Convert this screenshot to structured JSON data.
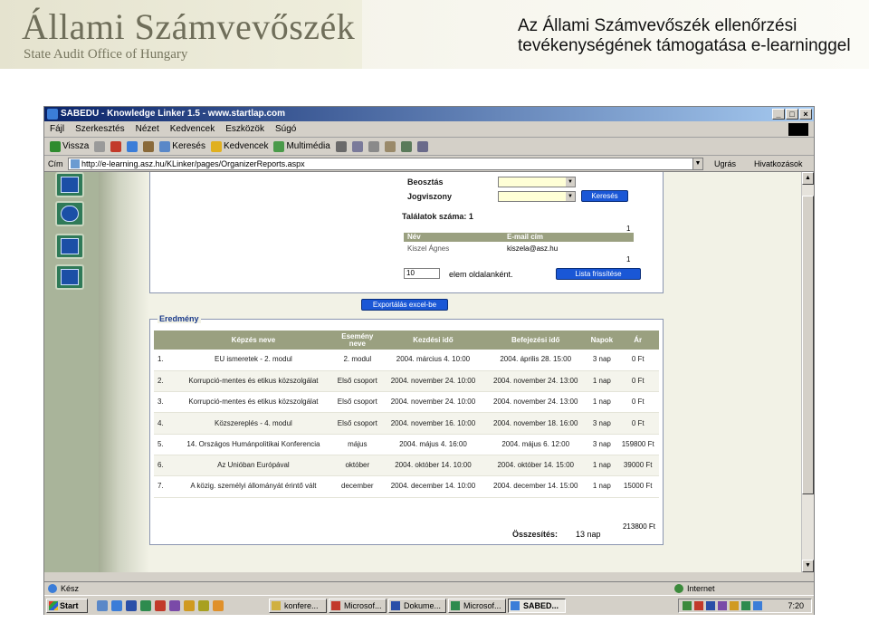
{
  "banner": {
    "logo_title": "Állami Számvevőszék",
    "logo_subtitle": "State Audit Office of Hungary",
    "slide_title_line1": "Az Állami Számvevőszék ellenőrzési",
    "slide_title_line2": "tevékenységének támogatása e-learninggel"
  },
  "browser": {
    "title": "SABEDU - Knowledge Linker 1.5 - www.startlap.com",
    "menu": [
      "Fájl",
      "Szerkesztés",
      "Nézet",
      "Kedvencek",
      "Eszközök",
      "Súgó"
    ],
    "toolbar": {
      "back": "Vissza",
      "search": "Keresés",
      "favorites": "Kedvencek",
      "multimedia": "Multimédia"
    },
    "address_label": "Cím",
    "address": "http://e-learning.asz.hu/KLinker/pages/OrganizerReports.aspx",
    "go": "Ugrás",
    "links": "Hivatkozások"
  },
  "filter": {
    "position_label": "Beosztás",
    "employment_label": "Jogviszony",
    "search_button": "Keresés",
    "results_count_label": "Találatok száma: 1",
    "page_number_top": "1",
    "page_number_bottom": "1",
    "col_name": "Név",
    "col_email": "E-mail cím",
    "row_name": "Kiszel Ágnes",
    "row_email": "kiszela@asz.hu",
    "per_page_value": "10",
    "per_page_label": "elem oldalanként.",
    "refresh_button": "Lista frissítése"
  },
  "export_button": "Exportálás excel-be",
  "result": {
    "legend": "Eredmény",
    "headers": [
      "",
      "Képzés neve",
      "Esemény neve",
      "Kezdési idő",
      "Befejezési idő",
      "Napok",
      "Ár"
    ],
    "rows": [
      {
        "num": "1.",
        "name": "EU ismeretek - 2. modul",
        "event": "2. modul",
        "start": "2004. március 4. 10:00",
        "end": "2004. április 28. 15:00",
        "days": "3 nap",
        "price": "0 Ft"
      },
      {
        "num": "2.",
        "name": "Korrupció-mentes és etikus közszolgálat",
        "event": "Első csoport",
        "start": "2004. november 24. 10:00",
        "end": "2004. november 24. 13:00",
        "days": "1 nap",
        "price": "0 Ft"
      },
      {
        "num": "3.",
        "name": "Korrupció-mentes és etikus közszolgálat",
        "event": "Első csoport",
        "start": "2004. november 24. 10:00",
        "end": "2004. november 24. 13:00",
        "days": "1 nap",
        "price": "0 Ft"
      },
      {
        "num": "4.",
        "name": "Közszereplés - 4. modul",
        "event": "Első csoport",
        "start": "2004. november 16. 10:00",
        "end": "2004. november 18. 16:00",
        "days": "3 nap",
        "price": "0 Ft"
      },
      {
        "num": "5.",
        "name": "14. Országos Humánpolitikai Konferencia",
        "event": "május",
        "start": "2004. május 4. 16:00",
        "end": "2004. május 6. 12:00",
        "days": "3 nap",
        "price": "159800 Ft"
      },
      {
        "num": "6.",
        "name": "Az Unióban Európával",
        "event": "október",
        "start": "2004. október 14. 10:00",
        "end": "2004. október 14. 15:00",
        "days": "1 nap",
        "price": "39000 Ft"
      },
      {
        "num": "7.",
        "name": "A közig. személyi állományát érintő vált",
        "event": "december",
        "start": "2004. december 14. 10:00",
        "end": "2004. december 14. 15:00",
        "days": "1 nap",
        "price": "15000 Ft"
      }
    ],
    "total_label": "Összesítés:",
    "total_days": "13 nap",
    "total_sum": "213800 Ft"
  },
  "status": {
    "text": "Kész",
    "zone": "Internet"
  },
  "taskbar": {
    "start": "Start",
    "tasks": [
      "konfere...",
      "Microsof...",
      "Dokume...",
      "Microsof...",
      "SABED..."
    ],
    "clock": "7:20"
  },
  "colors": {
    "header_olive": "#9aa080",
    "nav_green": "#a9b49a",
    "button_blue": "#1a57d6",
    "title_bar": "#0a246a"
  }
}
